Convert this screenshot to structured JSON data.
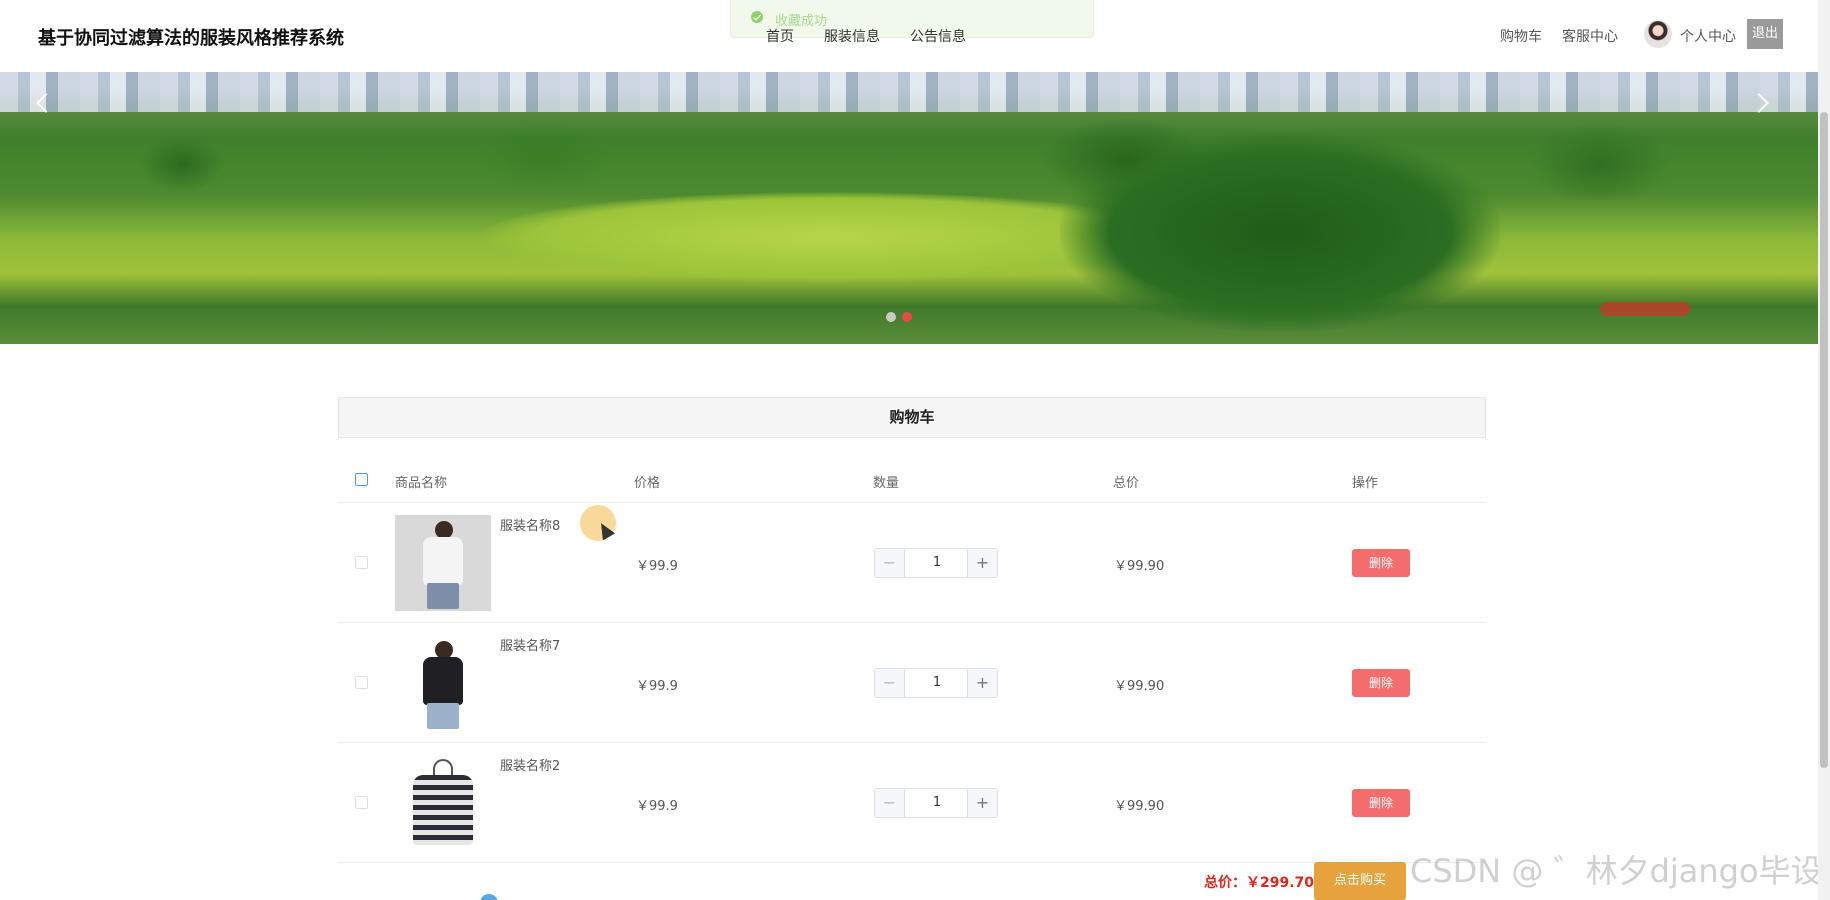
{
  "app": {
    "title": "基于协同过滤算法的服装风格推荐系统"
  },
  "toast": {
    "message": "收藏成功"
  },
  "nav": {
    "items": [
      "首页",
      "服装信息",
      "公告信息"
    ]
  },
  "user_bar": {
    "cart": "购物车",
    "service": "客服中心",
    "profile": "个人中心",
    "logout": "退出"
  },
  "banner": {
    "slide_count": 2,
    "active_index": 1
  },
  "cart": {
    "title": "购物车",
    "columns": [
      "商品名称",
      "价格",
      "数量",
      "总价",
      "操作"
    ],
    "items": [
      {
        "name": "服装名称8",
        "price": "￥99.9",
        "quantity": "1",
        "total": "￥99.90",
        "action": "删除",
        "image": "woman-tshirt"
      },
      {
        "name": "服装名称7",
        "price": "￥99.9",
        "quantity": "1",
        "total": "￥99.90",
        "action": "删除",
        "image": "black-polo"
      },
      {
        "name": "服装名称2",
        "price": "￥99.9",
        "quantity": "1",
        "total": "￥99.90",
        "action": "删除",
        "image": "striped-shirt"
      }
    ],
    "stepper": {
      "minus": "−",
      "plus": "+"
    },
    "summary_label": "总价：",
    "summary_value": "￥299.70",
    "buy_label": "点击购买"
  },
  "watermark": "CSDN @ ゛林夕django毕设",
  "colors": {
    "delete": "#f56c6c",
    "buy": "#e6a23c",
    "total_price": "#e1251b",
    "toast_bg": "#f0f9eb"
  }
}
